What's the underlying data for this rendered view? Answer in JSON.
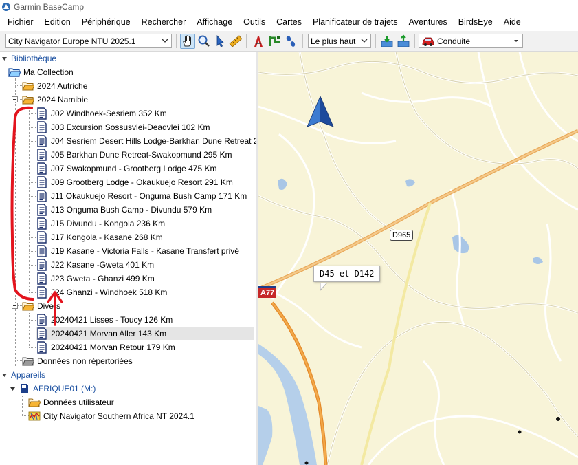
{
  "window": {
    "title": "Garmin BaseCamp"
  },
  "menu": [
    "Fichier",
    "Edition",
    "Périphérique",
    "Rechercher",
    "Affichage",
    "Outils",
    "Cartes",
    "Planificateur de trajets",
    "Aventures",
    "BirdsEye",
    "Aide"
  ],
  "toolbar": {
    "map_product": "City Navigator Europe NTU 2025.1",
    "detail_level": "Le plus haut",
    "activity_profile": "Conduite",
    "tools": [
      "hand-icon",
      "magnifier-icon",
      "pointer-arrow-icon",
      "ruler-icon",
      "new-waypoint-icon",
      "new-route-icon",
      "new-track-icon",
      "receive-from-device-icon",
      "send-to-device-icon",
      "car-icon"
    ]
  },
  "library": {
    "title": "Bibliothèque",
    "root": "Ma Collection",
    "folders": {
      "autriche": "2024 Autriche",
      "namibie": "2024 Namibie",
      "divers": "Divers",
      "unlisted": "Données non répertoriées"
    },
    "namibie_routes": [
      "J02 Windhoek-Sesriem 352 Km",
      "J03 Excursion Sossusvlei-Deadvlei 102 Km",
      "J04 Sesriem Desert Hills Lodge-Barkhan Dune Retreat 2...",
      "J05 Barkhan Dune Retreat-Swakopmund 295 Km",
      "J07 Swakopmund - Grootberg Lodge 475 Km",
      "J09 Grootberg Lodge - Okaukuejo Resort 291 Km",
      "J11 Okaukuejo Resort - Onguma Bush Camp 171 Km",
      "J13 Onguma Bush Camp  - Divundu 579 Km",
      "J15 Divundu - Kongola 236 Km",
      "J17 Kongola - Kasane 268 Km",
      "J19 Kasane - Victoria Falls - Kasane Transfert privé",
      "J22 Kasane  -Gweta 401 Km",
      "J23 Gweta - Ghanzi 499 Km",
      "J24 Ghanzi - Windhoek 518 Km"
    ],
    "divers_routes": [
      "20240421 Lisses - Toucy 126 Km",
      "20240421 Morvan Aller 143 Km",
      "20240421 Morvan Retour 179 Km"
    ]
  },
  "devices": {
    "title": "Appareils",
    "device": "AFRIQUE01 (M:)",
    "user_data": "Données utilisateur",
    "map": "City Navigator Southern Africa NT 2024.1"
  },
  "map": {
    "road_label": "D965",
    "shield": "A77",
    "tooltip": "D45 et D142"
  },
  "colors": {
    "accent_blue": "#1a4fa0",
    "selection": "#e5e5e5",
    "map_bg": "#f8f4d8",
    "annotation_red": "#e3141e"
  }
}
